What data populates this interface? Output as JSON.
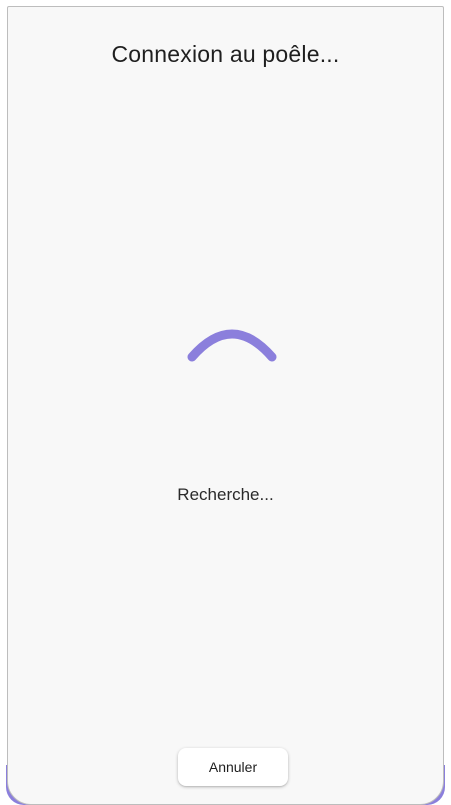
{
  "dialog": {
    "title": "Connexion au poêle...",
    "status_text": "Recherche...",
    "cancel_label": "Annuler"
  },
  "spinner": {
    "icon": "loading-spinner-icon",
    "color": "#8b7fdc"
  },
  "colors": {
    "accent": "#8b7fdc",
    "dialog_background": "#f8f8f8"
  }
}
